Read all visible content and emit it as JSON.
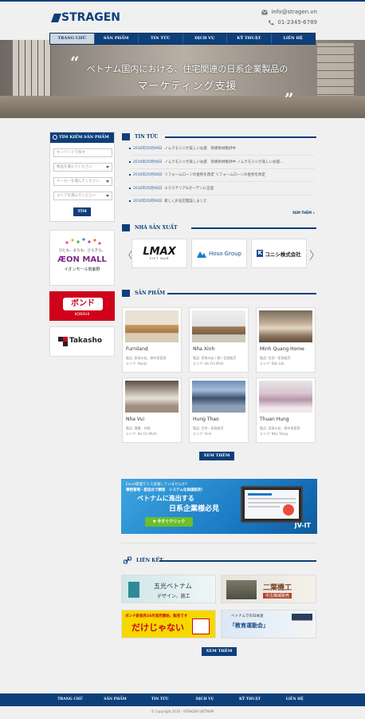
{
  "header": {
    "logo_text": "STRAGEN",
    "email": "info@stragen.vn",
    "phone": "01-2345-6789"
  },
  "nav": {
    "items": [
      "TRANG CHỦ",
      "SẢN PHẨM",
      "TIN TỨC",
      "DỊCH VỤ",
      "KỸ THUẬT",
      "LIÊN HỆ"
    ],
    "active_index": 0
  },
  "hero": {
    "line1": "ベトナム国内における、住宅関連の日系企業製品の",
    "line2": "マーケティング支援"
  },
  "search": {
    "title": "TÌM KIẾM SẢN PHẨM",
    "keyword_placeholder": "キーワードで探す",
    "select1": "製品を選んでください",
    "select2": "メーカーを選んでください",
    "select3": "エリアを選んでください",
    "button": "TÌM"
  },
  "side_logos": {
    "aeon_small": "ひとも、まちも、さらきら。",
    "aeon_main": "ÆON MALL",
    "aeon_sub": "イオンモール筑紫野",
    "bond": "ボンド",
    "bond_sub": "KONISHI",
    "takasho": "Takasho"
  },
  "news": {
    "title": "TIN TỨC",
    "more": "XEM THÊM",
    "items": [
      {
        "date": "2016年05月09日",
        "text": "ノムラモミジが美しいお庭　新規商材販評中"
      },
      {
        "date": "2016年05月06日",
        "text": "ノムラモミジが美しいお庭　新規商材販評中 ノムラモミジが美しいお庭..."
      },
      {
        "date": "2016年05月06日",
        "text": "リフォームローンの金利を改定 リフォームローンの金利を改定"
      },
      {
        "date": "2016年05月06日",
        "text": "エクステリア&ガーデンに正直"
      },
      {
        "date": "2016年05月06日",
        "text": "新しくJP支店開設しました"
      }
    ]
  },
  "makers": {
    "title": "NHÀ SẢN XUẤT",
    "brands": [
      "LMAX",
      "Hoso Group",
      "コニシ株式会社"
    ],
    "lmax_sub": "VIET NAM"
  },
  "products": {
    "title": "SẢN PHẨM",
    "more": "XEM THÊM",
    "items": [
      {
        "name": "Furniland",
        "meta1": "製品: 家具の店、都市家庭家",
        "meta2": "エリア: Hanoi"
      },
      {
        "name": "Nha Xinh",
        "meta1": "製品: 家具の店 / 都 / 住居販売",
        "meta2": "エリア: Ho Chi Minh"
      },
      {
        "name": "Minh Quang Home",
        "meta1": "製品: 住宅・家具販売",
        "meta2": "エリア: Dak Lak"
      },
      {
        "name": "Nha Vui",
        "meta1": "製品: 建築、内装",
        "meta2": "エリア: Ho Chi Minh"
      },
      {
        "name": "Hung Thao",
        "meta1": "製品: 住宅・家具販売",
        "meta2": "エリア: Vinh"
      },
      {
        "name": "Thuan Hung",
        "meta1": "製品: 家具の店、都市家庭家",
        "meta2": "エリア: Nha Trang"
      }
    ]
  },
  "jv_banner": {
    "small1": "Excel管理でミス多発していませんか？",
    "small2": "事務管理・配送台で顕客　システム化価値販売!",
    "main1": "ベトナムに進出する",
    "main2": "日系企業様必見",
    "button": "今すぐクリック",
    "logo": "JV-IT"
  },
  "links": {
    "title": "LIÊN KẾT",
    "more": "XEM THÊM",
    "cards": [
      {
        "l1": "五光ベトナム",
        "l2": "デザイン、施工"
      },
      {
        "l1": "二葉機工",
        "l2": "中古機械販売"
      },
      {
        "l1": "ボンド新発売10月発売開始、販売です",
        "l2": "だけじゃない"
      },
      {
        "l1": "ベトナムでの日本語",
        "l2": "「教育運動会」"
      }
    ]
  },
  "footer": {
    "items": [
      "TRANG CHỦ",
      "SẢN PHẨM",
      "TIN TỨC",
      "DỊCH VỤ",
      "KỸ THUẬT",
      "LIÊN HỆ"
    ],
    "copyright": "© Copyright 2016 - STRAGEN VIETNAM"
  },
  "colors": {
    "primary": "#0d3f7a",
    "link": "#2d63a8",
    "bond_red": "#d0021b",
    "jv_blue": "#1b7bc4",
    "cta_green": "#6bbf2a"
  }
}
